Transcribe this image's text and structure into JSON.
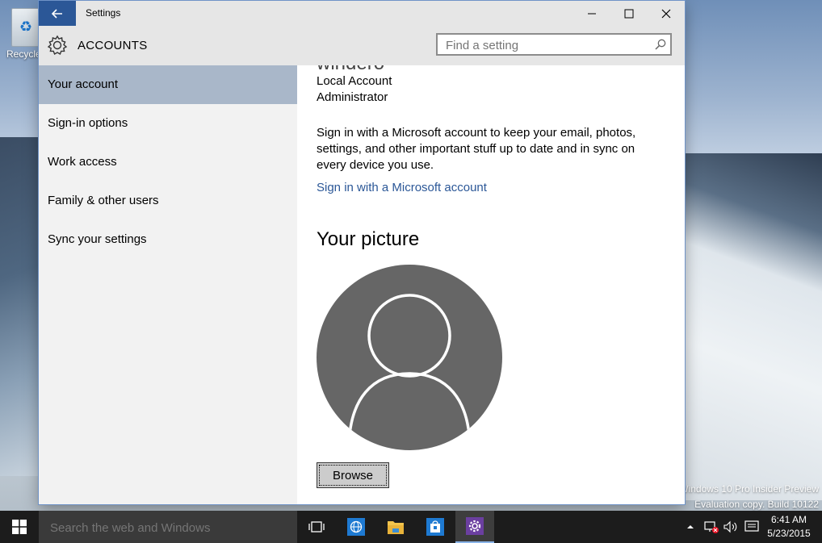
{
  "desktop": {
    "recycle_bin_label": "Recycle",
    "watermark_line1": "Windows 10 Pro Insider Preview",
    "watermark_line2": "Evaluation copy. Build 10122"
  },
  "window": {
    "title": "Settings",
    "section_title": "ACCOUNTS",
    "search_placeholder": "Find a setting"
  },
  "sidebar": {
    "items": [
      {
        "label": "Your account",
        "active": true
      },
      {
        "label": "Sign-in options",
        "active": false
      },
      {
        "label": "Work access",
        "active": false
      },
      {
        "label": "Family & other users",
        "active": false
      },
      {
        "label": "Sync your settings",
        "active": false
      }
    ]
  },
  "content": {
    "user_name": "windero",
    "account_type": "Local Account",
    "role": "Administrator",
    "description": "Sign in with a Microsoft account to keep your email, photos, settings, and other important stuff up to date and in sync on every device you use.",
    "ms_link": "Sign in with a Microsoft account",
    "picture_heading": "Your picture",
    "browse_label": "Browse"
  },
  "taskbar": {
    "search_placeholder": "Search the web and Windows",
    "time": "6:41 AM",
    "date": "5/23/2015",
    "accent": "#8ab4e8"
  },
  "colors": {
    "sidebar_active": "#a9b7c9",
    "back_button": "#2b5797",
    "link": "#2b5797"
  }
}
